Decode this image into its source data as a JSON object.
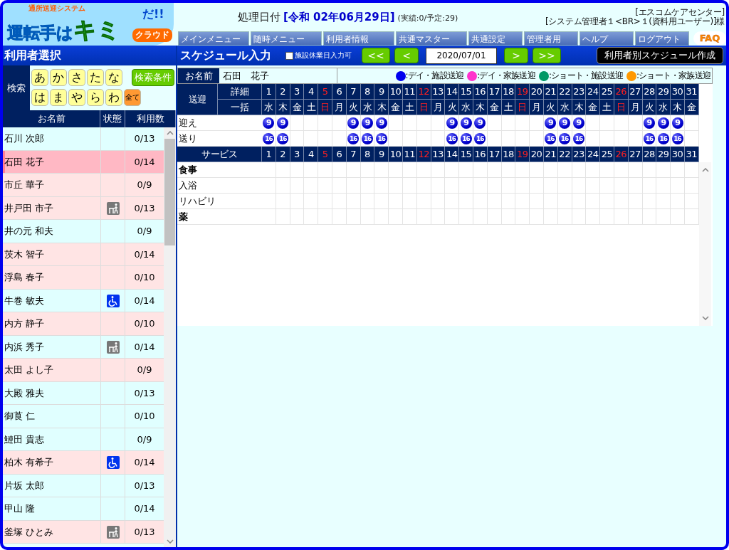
{
  "logo": {
    "tagline": "通所送迎システム",
    "main": "運転手は",
    "accent": "キミ",
    "exclaim": "だ!!",
    "cloud": "クラウド"
  },
  "header": {
    "date_label": "処理日付",
    "date_value": "[令和 02年06月29日]",
    "counts": "(実績:0/予定:29)",
    "office": "[エスコムケアセンター]",
    "user": "[システム管理者１<BR>１(資料用ユーザー)]様"
  },
  "nav": [
    "メインメニュー",
    "随時メニュー",
    "利用者情報",
    "共通マスター",
    "共通設定",
    "管理者用",
    "ヘルプ",
    "ログアウト"
  ],
  "faq": "FAQ",
  "left_panel": {
    "title": "利用者選択",
    "search_label": "検索",
    "kana_keys": [
      {
        "label": "あ",
        "kind": "kana"
      },
      {
        "label": "か",
        "kind": "kana"
      },
      {
        "label": "さ",
        "kind": "kana"
      },
      {
        "label": "た",
        "kind": "kana"
      },
      {
        "label": "な",
        "kind": "kana"
      },
      {
        "label": "は",
        "kind": "kana"
      },
      {
        "label": "ま",
        "kind": "kana"
      },
      {
        "label": "や",
        "kind": "kana"
      },
      {
        "label": "ら",
        "kind": "kana"
      },
      {
        "label": "わ",
        "kind": "kana"
      },
      {
        "label": "全て",
        "kind": "all"
      }
    ],
    "search_button": "検索条件",
    "columns": [
      "お名前",
      "状態",
      "利用数"
    ],
    "rows": [
      {
        "name": "石川 次郎",
        "kind": "plain",
        "count": "0/13",
        "color": "#e0ffff",
        "selected": false
      },
      {
        "name": "石田 花子",
        "kind": "plain",
        "count": "0/14",
        "color": "#ffb8c4",
        "selected": true
      },
      {
        "name": "市丘 華子",
        "kind": "plain",
        "count": "0/9",
        "color": "#ffe4e4",
        "selected": false
      },
      {
        "name": "井戸田 市子",
        "kind": "walker",
        "count": "0/13",
        "color": "#ffe4e4",
        "selected": false
      },
      {
        "name": "井の元 和夫",
        "kind": "plain",
        "count": "0/9",
        "color": "#e0ffff",
        "selected": false
      },
      {
        "name": "茨木 智子",
        "kind": "plain",
        "count": "0/14",
        "color": "#ffe4e4",
        "selected": false
      },
      {
        "name": "浮島 春子",
        "kind": "plain",
        "count": "0/10",
        "color": "#ffe4e4",
        "selected": false
      },
      {
        "name": "牛巻 敏夫",
        "kind": "wheelchair",
        "count": "0/14",
        "color": "#e0ffff",
        "selected": false
      },
      {
        "name": "内方 静子",
        "kind": "plain",
        "count": "0/10",
        "color": "#ffe4e4",
        "selected": false
      },
      {
        "name": "内浜 秀子",
        "kind": "walker",
        "count": "0/14",
        "color": "#e0ffff",
        "selected": false
      },
      {
        "name": "太田 よし子",
        "kind": "plain",
        "count": "0/9",
        "color": "#ffe4e4",
        "selected": false
      },
      {
        "name": "大殿 雅夫",
        "kind": "plain",
        "count": "0/13",
        "color": "#e0ffff",
        "selected": false
      },
      {
        "name": "御莨 仁",
        "kind": "plain",
        "count": "0/10",
        "color": "#e0ffff",
        "selected": false
      },
      {
        "name": "鰱田 貴志",
        "kind": "plain",
        "count": "0/9",
        "color": "#e0ffff",
        "selected": false
      },
      {
        "name": "柏木 有希子",
        "kind": "wheelchair",
        "count": "0/14",
        "color": "#ffe4e4",
        "selected": false
      },
      {
        "name": "片坂 太郎",
        "kind": "plain",
        "count": "0/13",
        "color": "#e0ffff",
        "selected": false
      },
      {
        "name": "甲山 隆",
        "kind": "plain",
        "count": "0/14",
        "color": "#e0ffff",
        "selected": false
      },
      {
        "name": "釜塚 ひとみ",
        "kind": "walker",
        "count": "0/13",
        "color": "#ffe4e4",
        "selected": false
      }
    ]
  },
  "schedule": {
    "title": "スケジュール入力",
    "holiday_checkbox": {
      "label": "施設休業日入力可",
      "checked": false
    },
    "nav_buttons": [
      "<<",
      "<"
    ],
    "date": "2020/07/01",
    "nav_buttons_after": [
      ">",
      ">>"
    ],
    "create_button": "利用者別スケジュール作成",
    "name_label": "お名前",
    "name": "石田　花子",
    "legend": [
      {
        "label": ":デイ・施設送迎",
        "color": "#0000ee"
      },
      {
        "label": ":デイ・家族送迎",
        "color": "#ff33cc"
      },
      {
        "label": ":ショート・施設送迎",
        "color": "#009966"
      },
      {
        "label": ":ショート・家族送迎",
        "color": "#ff9900"
      }
    ],
    "transport_label": "送迎",
    "detail_label": "詳細",
    "bulk_label": "一括",
    "pickup_label": "迎え",
    "dropoff_label": "送り",
    "service_label": "サービス",
    "days": [
      {
        "day": "1",
        "weekday": "水",
        "holiday": false,
        "pickup": "9",
        "dropoff": "16"
      },
      {
        "day": "2",
        "weekday": "木",
        "holiday": false,
        "pickup": "9",
        "dropoff": "16"
      },
      {
        "day": "3",
        "weekday": "金",
        "holiday": false
      },
      {
        "day": "4",
        "weekday": "土",
        "holiday": false
      },
      {
        "day": "5",
        "weekday": "日",
        "holiday": true
      },
      {
        "day": "6",
        "weekday": "月",
        "holiday": false
      },
      {
        "day": "7",
        "weekday": "火",
        "holiday": false,
        "pickup": "9",
        "dropoff": "16"
      },
      {
        "day": "8",
        "weekday": "水",
        "holiday": false,
        "pickup": "9",
        "dropoff": "16"
      },
      {
        "day": "9",
        "weekday": "木",
        "holiday": false,
        "pickup": "9",
        "dropoff": "16"
      },
      {
        "day": "10",
        "weekday": "金",
        "holiday": false
      },
      {
        "day": "11",
        "weekday": "土",
        "holiday": false
      },
      {
        "day": "12",
        "weekday": "日",
        "holiday": true
      },
      {
        "day": "13",
        "weekday": "月",
        "holiday": false
      },
      {
        "day": "14",
        "weekday": "火",
        "holiday": false,
        "pickup": "9",
        "dropoff": "16"
      },
      {
        "day": "15",
        "weekday": "水",
        "holiday": false,
        "pickup": "9",
        "dropoff": "16"
      },
      {
        "day": "16",
        "weekday": "木",
        "holiday": false,
        "pickup": "9",
        "dropoff": "16"
      },
      {
        "day": "17",
        "weekday": "金",
        "holiday": false
      },
      {
        "day": "18",
        "weekday": "土",
        "holiday": false
      },
      {
        "day": "19",
        "weekday": "日",
        "holiday": true
      },
      {
        "day": "20",
        "weekday": "月",
        "holiday": false
      },
      {
        "day": "21",
        "weekday": "火",
        "holiday": false,
        "pickup": "9",
        "dropoff": "16"
      },
      {
        "day": "22",
        "weekday": "水",
        "holiday": false,
        "pickup": "9",
        "dropoff": "16"
      },
      {
        "day": "23",
        "weekday": "木",
        "holiday": false,
        "pickup": "9",
        "dropoff": "16"
      },
      {
        "day": "24",
        "weekday": "金",
        "holiday": false
      },
      {
        "day": "25",
        "weekday": "土",
        "holiday": false
      },
      {
        "day": "26",
        "weekday": "日",
        "holiday": true
      },
      {
        "day": "27",
        "weekday": "月",
        "holiday": false
      },
      {
        "day": "28",
        "weekday": "火",
        "holiday": false,
        "pickup": "9",
        "dropoff": "16"
      },
      {
        "day": "29",
        "weekday": "水",
        "holiday": false,
        "pickup": "9",
        "dropoff": "16"
      },
      {
        "day": "30",
        "weekday": "木",
        "holiday": false,
        "pickup": "9",
        "dropoff": "16"
      },
      {
        "day": "31",
        "weekday": "金",
        "holiday": false
      }
    ],
    "service_days": [
      {
        "day": "1",
        "holiday": false
      },
      {
        "day": "2",
        "holiday": false
      },
      {
        "day": "3",
        "holiday": false
      },
      {
        "day": "4",
        "holiday": false
      },
      {
        "day": "5",
        "holiday": true
      },
      {
        "day": "6",
        "holiday": false
      },
      {
        "day": "7",
        "holiday": false
      },
      {
        "day": "8",
        "holiday": false
      },
      {
        "day": "9",
        "holiday": false
      },
      {
        "day": "10",
        "holiday": false
      },
      {
        "day": "11",
        "holiday": false
      },
      {
        "day": "12",
        "holiday": true
      },
      {
        "day": "13",
        "holiday": false
      },
      {
        "day": "14",
        "holiday": false
      },
      {
        "day": "15",
        "holiday": false
      },
      {
        "day": "16",
        "holiday": false
      },
      {
        "day": "17",
        "holiday": false
      },
      {
        "day": "18",
        "holiday": false
      },
      {
        "day": "19",
        "holiday": true
      },
      {
        "day": "20",
        "holiday": false
      },
      {
        "day": "21",
        "holiday": false
      },
      {
        "day": "22",
        "holiday": false
      },
      {
        "day": "23",
        "holiday": false
      },
      {
        "day": "24",
        "holiday": false
      },
      {
        "day": "25",
        "holiday": false
      },
      {
        "day": "26",
        "holiday": true
      },
      {
        "day": "27",
        "holiday": false
      },
      {
        "day": "28",
        "holiday": false
      },
      {
        "day": "29",
        "holiday": false
      },
      {
        "day": "30",
        "holiday": false
      },
      {
        "day": "31",
        "holiday": false
      }
    ],
    "services": [
      {
        "label": "食事",
        "kind": "bold"
      },
      {
        "label": "入浴",
        "kind": "plain"
      },
      {
        "label": "リハビリ",
        "kind": "plain"
      },
      {
        "label": "薬",
        "kind": "bold"
      }
    ]
  }
}
